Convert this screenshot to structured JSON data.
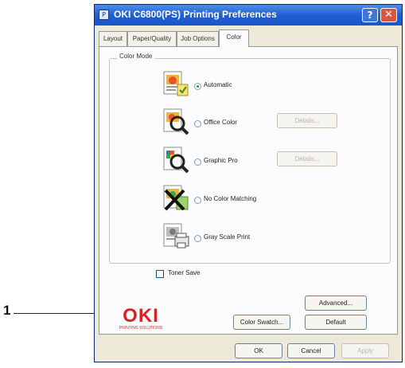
{
  "callout": {
    "number": "1"
  },
  "window": {
    "title": "OKI C6800(PS) Printing Preferences",
    "help_label": "?",
    "close_label": "✕",
    "title_icon_label": "P"
  },
  "tabs": [
    {
      "label": "Layout",
      "active": false
    },
    {
      "label": "Paper/Quality",
      "active": false
    },
    {
      "label": "Job Options",
      "active": false
    },
    {
      "label": "Color",
      "active": true
    }
  ],
  "color_mode": {
    "label": "Color Mode",
    "options": [
      {
        "label": "Automatic",
        "selected": true,
        "icon": "automatic-color-icon"
      },
      {
        "label": "Office Color",
        "selected": false,
        "icon": "office-color-icon",
        "details_label": "Details..."
      },
      {
        "label": "Graphic Pro",
        "selected": false,
        "icon": "graphic-pro-icon",
        "details_label": "Details..."
      },
      {
        "label": "No Color Matching",
        "selected": false,
        "icon": "no-color-matching-icon"
      },
      {
        "label": "Gray Scale Print",
        "selected": false,
        "icon": "gray-scale-print-icon"
      }
    ]
  },
  "toner_save": {
    "label": "Toner Save",
    "checked": false
  },
  "brand": {
    "logo_text": "OKI",
    "tagline": "PRINTING SOLUTIONS",
    "color": "#d92027"
  },
  "buttons": {
    "color_swatch": "Color Swatch...",
    "advanced": "Advanced...",
    "default": "Default",
    "ok": "OK",
    "cancel": "Cancel",
    "apply": "Apply"
  }
}
